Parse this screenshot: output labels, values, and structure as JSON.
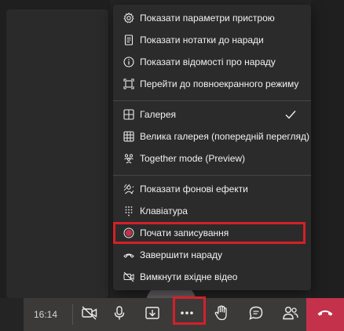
{
  "menu": {
    "items": [
      {
        "label": "Показати параметри пристрою",
        "icon": "gear-icon"
      },
      {
        "label": "Показати нотатки до наради",
        "icon": "notes-icon"
      },
      {
        "label": "Показати відомості про нараду",
        "icon": "info-icon"
      },
      {
        "label": "Перейти до повноекранного режиму",
        "icon": "fullscreen-icon"
      },
      {
        "label": "Галерея",
        "icon": "gallery-icon",
        "checked": true
      },
      {
        "label": "Велика галерея (попередній перегляд)",
        "icon": "large-gallery-icon"
      },
      {
        "label": "Together mode (Preview)",
        "icon": "together-mode-icon"
      },
      {
        "label": "Показати фонові ефекти",
        "icon": "background-effects-icon"
      },
      {
        "label": "Клавіатура",
        "icon": "keypad-icon"
      },
      {
        "label": "Почати записування",
        "icon": "record-icon",
        "highlighted": true
      },
      {
        "label": "Завершити нараду",
        "icon": "end-meeting-icon"
      },
      {
        "label": "Вимкнути вхідне відео",
        "icon": "video-off-icon"
      }
    ]
  },
  "toolbar": {
    "time": "16:14",
    "buttons": [
      "camera-off-icon",
      "microphone-icon",
      "share-icon",
      "more-icon",
      "raise-hand-icon",
      "chat-icon",
      "participants-icon",
      "hang-up-icon"
    ]
  },
  "colors": {
    "highlight": "#d42028",
    "menu_bg": "#2b2b2b",
    "toolbar_bg": "#3b3a39",
    "hangup": "#c4314b",
    "record_dot": "#c4314b"
  }
}
